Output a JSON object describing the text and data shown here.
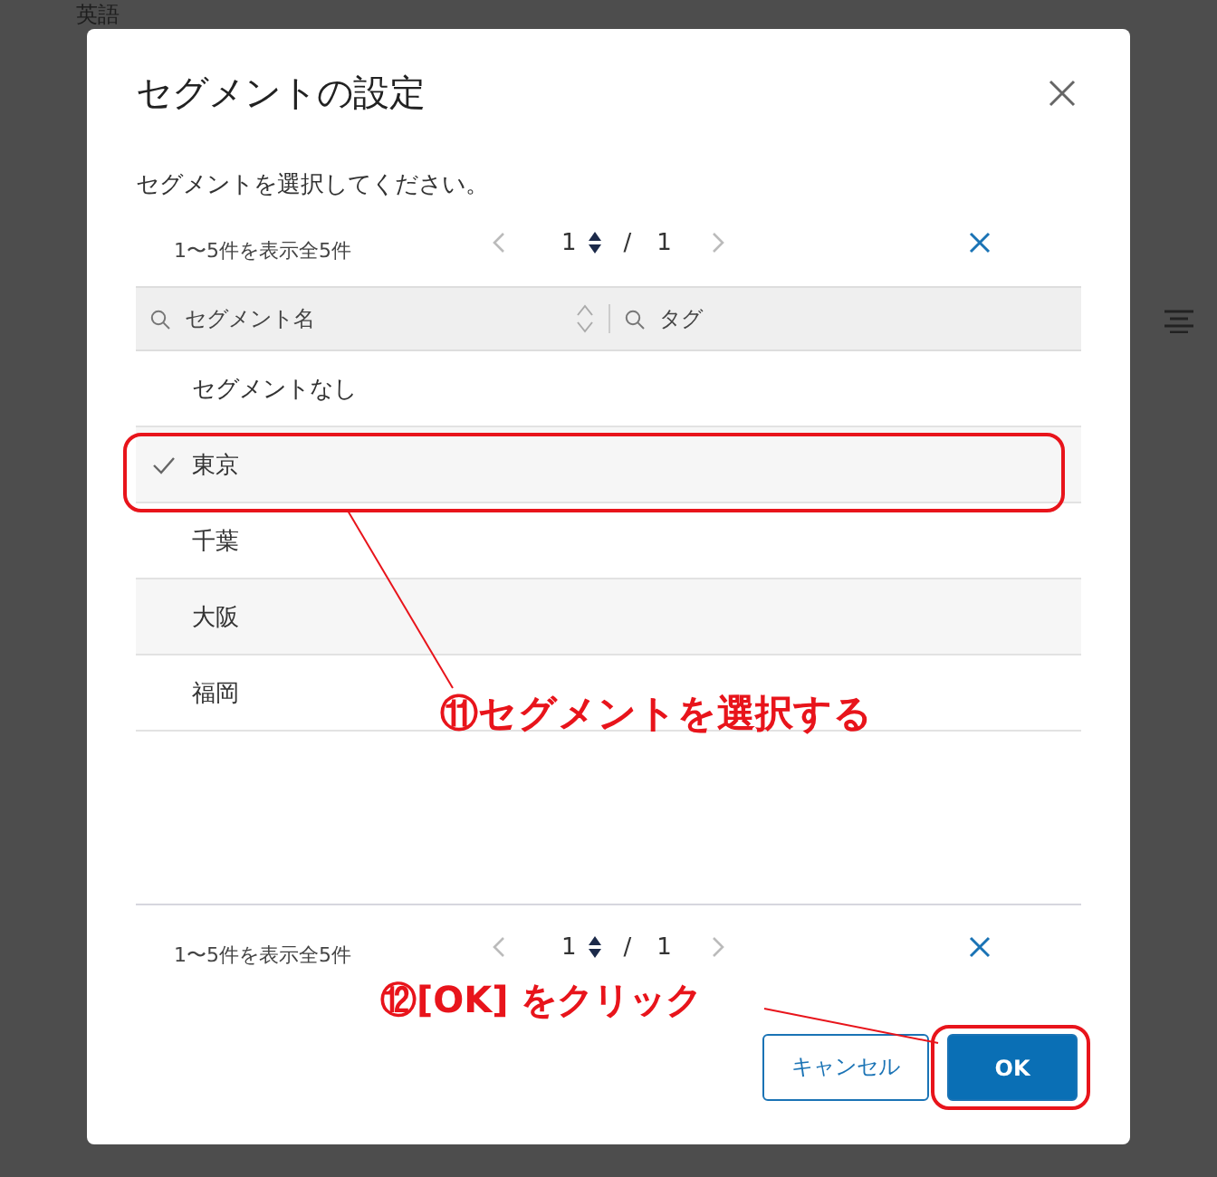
{
  "background": {
    "heading": "英語"
  },
  "dialog": {
    "title": "セグメントの設定",
    "instruction": "セグメントを選択してください。",
    "pager_top": {
      "summary": "1〜5件を表示全5件",
      "page": "1",
      "separator": "/",
      "total": "1"
    },
    "columns": [
      {
        "label": "セグメント名",
        "sortable": true
      },
      {
        "label": "タグ",
        "sortable": false
      }
    ],
    "rows": [
      {
        "name": "セグメントなし",
        "selected": false
      },
      {
        "name": "東京",
        "selected": true
      },
      {
        "name": "千葉",
        "selected": false
      },
      {
        "name": "大阪",
        "selected": false
      },
      {
        "name": "福岡",
        "selected": false
      }
    ],
    "pager_bottom": {
      "summary": "1〜5件を表示全5件",
      "page": "1",
      "separator": "/",
      "total": "1"
    },
    "buttons": [
      {
        "label": "キャンセル",
        "kind": "secondary"
      },
      {
        "label": "OK",
        "kind": "primary"
      }
    ]
  },
  "annotations": [
    {
      "label": "⑪セグメントを選択する"
    },
    {
      "label": "⑫[OK] をクリック"
    }
  ]
}
